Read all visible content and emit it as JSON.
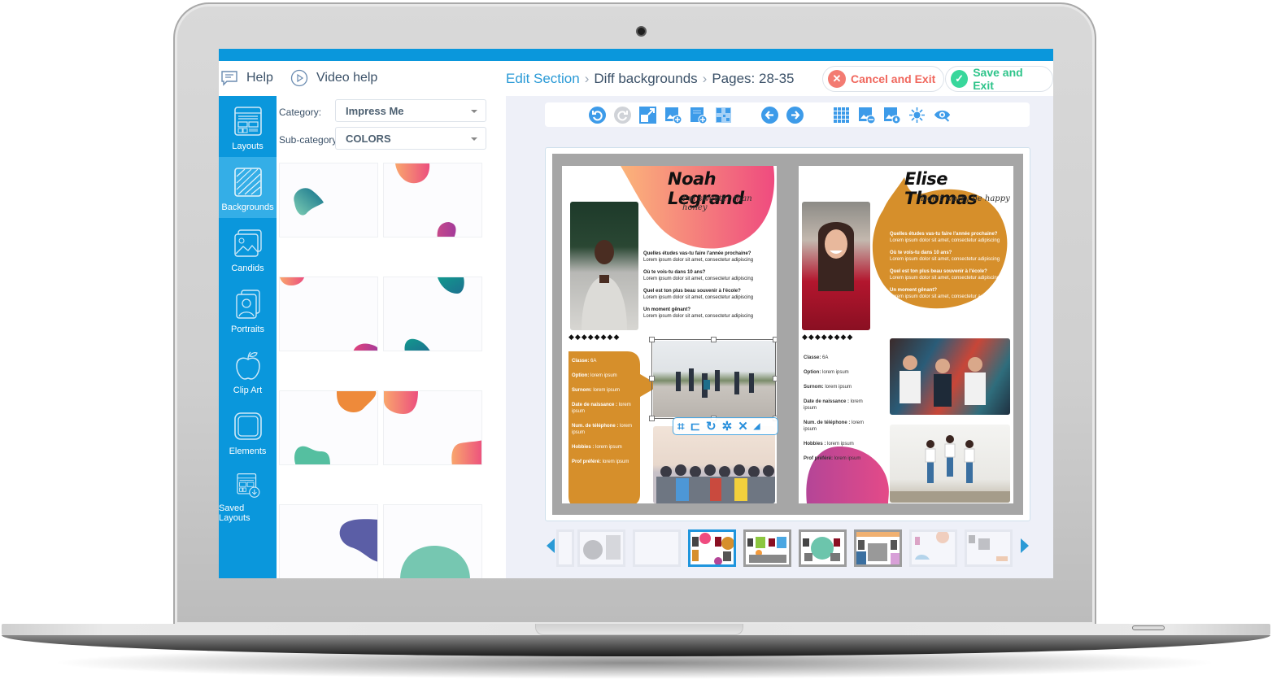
{
  "header": {
    "help_label": "Help",
    "video_help_label": "Video help",
    "breadcrumb": [
      "Edit Section",
      "Diff backgrounds",
      "Pages: 28-35"
    ],
    "cancel_label": "Cancel and Exit",
    "save_label": "Save and Exit"
  },
  "sidebar": {
    "items": [
      {
        "label": "Layouts",
        "icon": "layouts-icon"
      },
      {
        "label": "Backgrounds",
        "icon": "backgrounds-icon",
        "active": true
      },
      {
        "label": "Candids",
        "icon": "candids-icon"
      },
      {
        "label": "Portraits",
        "icon": "portraits-icon"
      },
      {
        "label": "Clip Art",
        "icon": "clip-art-icon"
      },
      {
        "label": "Elements",
        "icon": "elements-icon"
      },
      {
        "label": "Saved Layouts",
        "icon": "saved-layouts-icon"
      }
    ]
  },
  "panel": {
    "category_label": "Category:",
    "category_value": "Impress Me",
    "subcategory_label": "Sub-category:",
    "subcategory_value": "COLORS",
    "thumbnails": 8
  },
  "toolbar": {
    "icons": [
      "undo-icon",
      "redo-icon",
      "resize-icon",
      "add-image-icon",
      "add-page-icon",
      "qr-code-icon",
      "previous-page-icon",
      "next-page-icon",
      "grid-icon",
      "swap-image-icon",
      "image-fill-icon",
      "brightness-icon",
      "preview-icon"
    ]
  },
  "left_page": {
    "name": "Noah Legrand",
    "motto": "I'm sweeter than honey",
    "questions": [
      {
        "q": "Quelles études vas-tu faire l'année prochaine?",
        "a": "Lorem ipsum dolor sit amet, consectetur adipiscing"
      },
      {
        "q": "Où te vois-tu dans 10 ans?",
        "a": "Lorem ipsum dolor sit amet, consectetur adipiscing"
      },
      {
        "q": "Quel est ton plus beau souvenir à l'école?",
        "a": "Lorem ipsum dolor sit amet, consectetur adipiscing"
      },
      {
        "q": "Un moment gênant?",
        "a": "Lorem ipsum dolor sit amet, consectetur adipiscing"
      }
    ],
    "diamonds": "◆◆◆◆◆◆◆◆",
    "info": [
      {
        "k": "Classe:",
        "v": "6A"
      },
      {
        "k": "Option:",
        "v": "lorem ipsum"
      },
      {
        "k": "Surnom:",
        "v": "lorem ipsum"
      },
      {
        "k": "Date de naissance :",
        "v": "lorem ipsum"
      },
      {
        "k": "Num. de téléphone :",
        "v": "lorem ipsum"
      },
      {
        "k": "Hobbies :",
        "v": "lorem ipsum"
      },
      {
        "k": "Prof préféré:",
        "v": "lorem ipsum"
      }
    ]
  },
  "right_page": {
    "name": "Elise Thomas",
    "motto": "Don't worry be happy",
    "questions": [
      {
        "q": "Quelles études vas-tu faire l'année prochaine?",
        "a": "Lorem ipsum dolor sit amet, consectetur adipiscing"
      },
      {
        "q": "Où te vois-tu dans 10 ans?",
        "a": "Lorem ipsum dolor sit amet, consectetur adipiscing"
      },
      {
        "q": "Quel est ton plus beau souvenir à l'école?",
        "a": "Lorem ipsum dolor sit amet, consectetur adipiscing"
      },
      {
        "q": "Un moment gênant?",
        "a": "Lorem ipsum dolor sit amet, consectetur adipiscing"
      }
    ],
    "diamonds": "◆◆◆◆◆◆◆◆",
    "info": [
      {
        "k": "Classe:",
        "v": "6A"
      },
      {
        "k": "Option:",
        "v": "lorem ipsum"
      },
      {
        "k": "Surnom:",
        "v": "lorem ipsum"
      },
      {
        "k": "Date de naissance :",
        "v": "lorem ipsum"
      },
      {
        "k": "Num. de téléphone :",
        "v": "lorem ipsum"
      },
      {
        "k": "Hobbies :",
        "v": "lorem ipsum"
      },
      {
        "k": "Prof préféré:",
        "v": "lorem ipsum"
      }
    ]
  },
  "image_toolbar": {
    "icons": [
      "crop-icon",
      "frame-icon",
      "rotate-icon",
      "magic-wand-icon",
      "delete-icon",
      "resize-corner-icon"
    ]
  },
  "filmstrip": {
    "count": 8,
    "active_index": 2
  },
  "colors": {
    "brand_blue": "#0a97dc",
    "cancel_red": "#f0675d",
    "save_green": "#2ec48a",
    "ochre": "#d68f2b"
  }
}
